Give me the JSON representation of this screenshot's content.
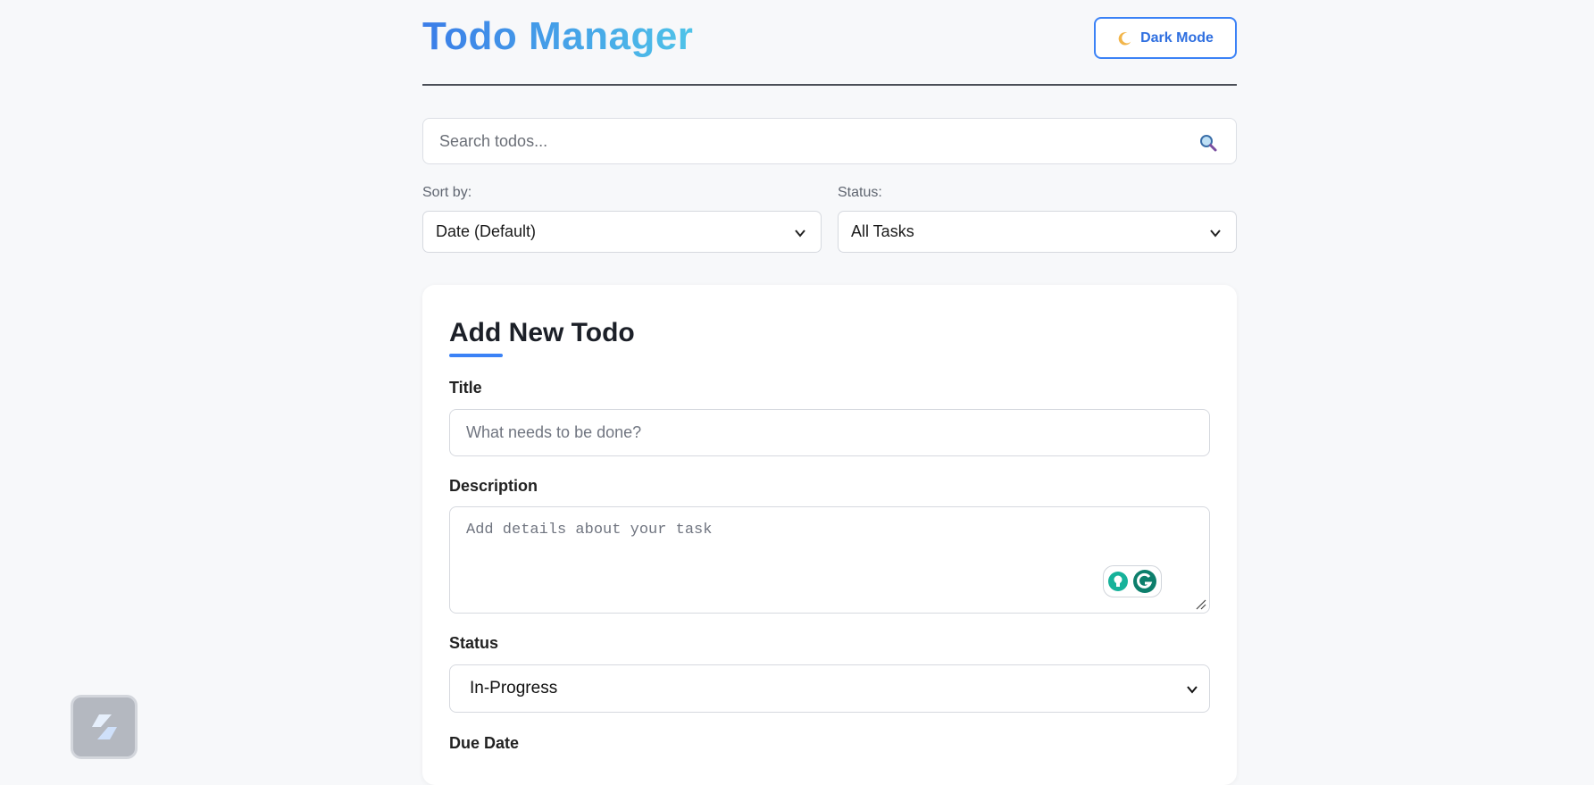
{
  "header": {
    "title": "Todo Manager",
    "dark_mode_label": "Dark Mode",
    "dark_mode_icon": "moon-icon"
  },
  "search": {
    "placeholder": "Search todos...",
    "value": "",
    "icon": "search-icon"
  },
  "filters": {
    "sort_label": "Sort by:",
    "sort_value": "Date (Default)",
    "status_label": "Status:",
    "status_value": "All Tasks"
  },
  "form": {
    "heading": "Add New Todo",
    "title_label": "Title",
    "title_placeholder": "What needs to be done?",
    "description_label": "Description",
    "description_placeholder": "Add details about your task",
    "status_label": "Status",
    "status_value": "In-Progress",
    "due_date_label": "Due Date"
  },
  "colors": {
    "accent": "#3b82f6",
    "title_gradient_start": "#3b7de8",
    "title_gradient_end": "#4fc3e8",
    "background": "#f7f8fa",
    "card": "#ffffff"
  }
}
